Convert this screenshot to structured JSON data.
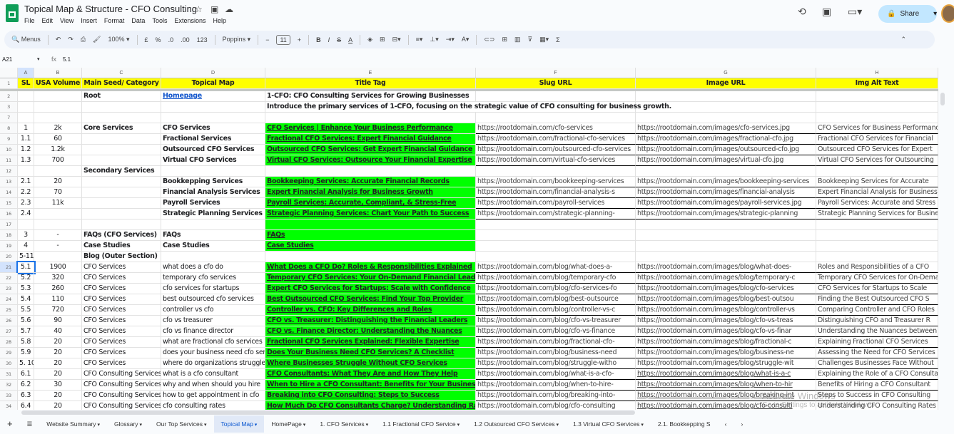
{
  "app": {
    "title": "Topical Map & Structure -  CFO Consulting",
    "menu": [
      "File",
      "Edit",
      "View",
      "Insert",
      "Format",
      "Data",
      "Tools",
      "Extensions",
      "Help"
    ],
    "share_label": "Share"
  },
  "toolbar": {
    "search": "Menus",
    "zoom": "100%",
    "currency": "£",
    "percent": "%",
    "dec_less": ".0",
    "dec_more": ".00",
    "format_num": "123",
    "font": "Poppins",
    "font_size": "11"
  },
  "formula_bar": {
    "cell_ref": "A21",
    "fx": "fx",
    "value": "5.1"
  },
  "columns": [
    "A",
    "B",
    "C",
    "D",
    "E",
    "F",
    "G",
    "H"
  ],
  "header": [
    "SL",
    "USA Volume",
    "Main Seed/ Category",
    "Topical Map",
    "Title Tag",
    "Slug URL",
    "Image URL",
    "Img Alt Text"
  ],
  "rows": [
    {
      "n": "2",
      "cells": [
        "",
        "",
        "Root",
        "Homepage",
        "1-CFO: CFO Consulting Services for Growing Businesses",
        "",
        "",
        ""
      ]
    },
    {
      "n": "3",
      "cells": [
        "",
        "",
        "",
        "",
        "Introduce the primary services of 1-CFO, focusing on the strategic value of CFO consulting for business growth.",
        "",
        "",
        ""
      ]
    },
    {
      "n": "7",
      "cells": [
        "",
        "",
        "",
        "",
        "",
        "",
        "",
        ""
      ]
    },
    {
      "n": "8",
      "cells": [
        "1",
        "2k",
        "Core Services",
        "CFO Services",
        "CFO Services | Enhance Your Business Performance",
        "https://rootdomain.com/cfo-services",
        "https://rootdomain.com/images/cfo-services.jpg",
        "CFO Services for Business Performance"
      ]
    },
    {
      "n": "9",
      "cells": [
        "1.1",
        "60",
        "",
        "Fractional Services",
        "Fractional CFO Services: Expert Financial Guidance",
        "https://rootdomain.com/fractional-cfo-services",
        "https://rootdomain.com/images/fractional-cfo.jpg",
        "Fractional CFO Services for Financial"
      ]
    },
    {
      "n": "10",
      "cells": [
        "1.2",
        "1.2k",
        "",
        "Outsourced CFO Services",
        "Outsourced CFO Services: Get Expert Financial Guidance",
        "https://rootdomain.com/outsourced-cfo-services",
        "https://rootdomain.com/images/outsourced-cfo.jpg",
        "Outsourced CFO Services for Expert"
      ]
    },
    {
      "n": "11",
      "cells": [
        "1.3",
        "700",
        "",
        "Virtual CFO Services",
        "Virtual CFO Services: Outsource Your Financial Expertise",
        "https://rootdomain.com/virtual-cfo-services",
        "https://rootdomain.com/images/virtual-cfo.jpg",
        "Virtual CFO Services for Outsourcing"
      ]
    },
    {
      "n": "12",
      "cells": [
        "",
        "",
        "Secondary Services",
        "",
        "",
        "",
        "",
        ""
      ]
    },
    {
      "n": "13",
      "cells": [
        "2.1",
        "20",
        "",
        "Bookkepping Services",
        "Bookkeeping Services: Accurate Financial Records",
        "https://rootdomain.com/bookkeeping-services",
        "https://rootdomain.com/images/bookkeeping-services",
        "Bookkeeping Services for Accurate"
      ]
    },
    {
      "n": "14",
      "cells": [
        "2.2",
        "70",
        "",
        "Financial Analysis Services",
        "Expert Financial Analysis for Business Growth",
        "https://rootdomain.com/financial-analysis-s",
        "https://rootdomain.com/images/financial-analysis",
        "Expert Financial Analysis for Business"
      ]
    },
    {
      "n": "15",
      "cells": [
        "2.3",
        "11k",
        "",
        "Payroll Services",
        "Payroll Services: Accurate, Compliant, & Stress-Free",
        "https://rootdomain.com/payroll-services",
        "https://rootdomain.com/images/payroll-services.jpg",
        "Payroll Services: Accurate and Stress"
      ]
    },
    {
      "n": "16",
      "cells": [
        "2.4",
        "",
        "",
        "Strategic Planning Services",
        "Strategic Planning Services: Chart Your Path to Success",
        "https://rootdomain.com/strategic-planning-",
        "https://rootdomain.com/images/strategic-planning",
        "Strategic Planning Services for Business"
      ]
    },
    {
      "n": "17",
      "cells": [
        "",
        "",
        "",
        "",
        "",
        "",
        "",
        ""
      ]
    },
    {
      "n": "18",
      "cells": [
        "3",
        "-",
        "FAQs (CFO Services)",
        "FAQs",
        "FAQs",
        "",
        "",
        ""
      ]
    },
    {
      "n": "19",
      "cells": [
        "4",
        "-",
        "Case Studies",
        "Case Studies",
        "Case Studies",
        "",
        "",
        ""
      ]
    },
    {
      "n": "20",
      "cells": [
        "5-11",
        "",
        "Blog (Outer Section)",
        "",
        "",
        "",
        "",
        ""
      ]
    },
    {
      "n": "21",
      "cells": [
        "5.1",
        "1900",
        "CFO Services",
        "what does a cfo do",
        "What Does a CFO Do? Roles & Responsibilities Explained",
        "https://rootdomain.com/blog/what-does-a-",
        "https://rootdomain.com/images/blog/what-does-",
        "Roles and Responsibilities of a CFO"
      ]
    },
    {
      "n": "22",
      "cells": [
        "5.2",
        "320",
        "CFO Services",
        "temporary cfo services",
        "Temporary CFO Services: Your On-Demand Financial Lead",
        "https://rootdomain.com/blog/temporary-cfo",
        "https://rootdomain.com/images/blog/temporary-c",
        "Temporary CFO Services for On-Demand"
      ]
    },
    {
      "n": "23",
      "cells": [
        "5.3",
        "260",
        "CFO Services",
        "cfo services for startups",
        "Expert CFO Services for Startups: Scale with Confidence",
        "https://rootdomain.com/blog/cfo-services-fo",
        "https://rootdomain.com/images/blog/cfo-services",
        "CFO Services for Startups to Scale"
      ]
    },
    {
      "n": "24",
      "cells": [
        "5.4",
        "110",
        "CFO Services",
        "best outsourced cfo services",
        "Best Outsourced CFO Services: Find Your Top Provider",
        "https://rootdomain.com/blog/best-outsource",
        "https://rootdomain.com/images/blog/best-outsou",
        "Finding the Best Outsourced CFO S"
      ]
    },
    {
      "n": "25",
      "cells": [
        "5.5",
        "720",
        "CFO Services",
        "controller vs cfo",
        "Controller vs. CFO: Key Differences and Roles",
        "https://rootdomain.com/blog/controller-vs-c",
        "https://rootdomain.com/images/blog/controller-vs",
        "Comparing Controller and CFO Roles"
      ]
    },
    {
      "n": "26",
      "cells": [
        "5.6",
        "90",
        "CFO Services",
        "cfo vs treasurer",
        "CFO vs. Treasurer: Distinguishing the Financial Leaders",
        "https://rootdomain.com/blog/cfo-vs-treasurer",
        "https://rootdomain.com/images/blog/cfo-vs-treas",
        "Distinguishing CFO and Treasurer R"
      ]
    },
    {
      "n": "27",
      "cells": [
        "5.7",
        "40",
        "CFO Services",
        "cfo vs finance director",
        "CFO vs. Finance Director: Understanding the Nuances",
        "https://rootdomain.com/blog/cfo-vs-finance",
        "https://rootdomain.com/images/blog/cfo-vs-finar",
        "Understanding the Nuances between"
      ]
    },
    {
      "n": "28",
      "cells": [
        "5.8",
        "20",
        "CFO Services",
        "what are fractional cfo services",
        "Fractional CFO Services Explained: Flexible Expertise",
        "https://rootdomain.com/blog/fractional-cfo-",
        "https://rootdomain.com/images/blog/fractional-c",
        "Explaining Fractional CFO Services"
      ]
    },
    {
      "n": "29",
      "cells": [
        "5.9",
        "20",
        "CFO Services",
        "does your business need cfo services",
        "Does Your Business Need CFO Services? A Checklist",
        "https://rootdomain.com/blog/business-need",
        "https://rootdomain.com/images/blog/business-ne",
        "Assessing the Need for CFO Services"
      ]
    },
    {
      "n": "30",
      "cells": [
        "5. 10",
        "20",
        "CFO Services",
        "where do organizations struggle",
        "Where Businesses Struggle Without CFO Services",
        "https://rootdomain.com/blog/struggle-witho",
        "https://rootdomain.com/images/blog/struggle-wit",
        "Challenges Businesses Face Without"
      ]
    },
    {
      "n": "31",
      "cells": [
        "6.1",
        "20",
        "CFO Consulting Services",
        "what is a cfo consultant",
        "CFO Consultants: What They Are and How They Help",
        "https://rootdomain.com/blog/what-is-a-cfo-",
        "https://rootdomain.com/images/blog/what-is-a-c",
        "Explaining the Role of a CFO Consultant"
      ]
    },
    {
      "n": "32",
      "cells": [
        "6.2",
        "30",
        "CFO Consulting Services",
        "why and when should you hire",
        "When to Hire a CFO Consultant: Benefits for Your Business",
        "https://rootdomain.com/blog/when-to-hire-",
        "https://rootdomain.com/images/blog/when-to-hir",
        "Benefits of Hiring a CFO Consultant"
      ]
    },
    {
      "n": "33",
      "cells": [
        "6.3",
        "20",
        "CFO Consulting Services",
        "how to get appointment in cfo",
        "Breaking into CFO Consulting: Steps to Success",
        "https://rootdomain.com/blog/breaking-into-",
        "https://rootdomain.com/images/blog/breaking-int",
        "Steps to Success in CFO Consulting"
      ]
    },
    {
      "n": "34",
      "cells": [
        "6.4",
        "20",
        "CFO Consulting Services",
        "cfo consulting rates",
        "How Much Do CFO Consultants Charge? Understanding Rates",
        "https://rootdomain.com/blog/cfo-consulting",
        "https://rootdomain.com/images/blog/cfo-consulti",
        "Understanding CFO Consulting Rates"
      ]
    }
  ],
  "sheet_tabs": [
    "Website Summary",
    "Glossary",
    "Our Top Services",
    "Topical Map",
    "HomePage",
    "1. CFO Services",
    "1.1 Fractional CFO Service",
    "1.2 Outsourced CFO Services",
    "1.3 Virtual CFO Services",
    "2.1. Bookkepping S"
  ],
  "active_tab": "Topical Map",
  "watermark": {
    "line1": "Activate Windows",
    "line2": "Go to Settings to activate Windows."
  },
  "colors": {
    "header_fill": "#ffff00",
    "title_fill": "#00ff00",
    "link": "#1155cc",
    "selection": "#1a73e8"
  }
}
